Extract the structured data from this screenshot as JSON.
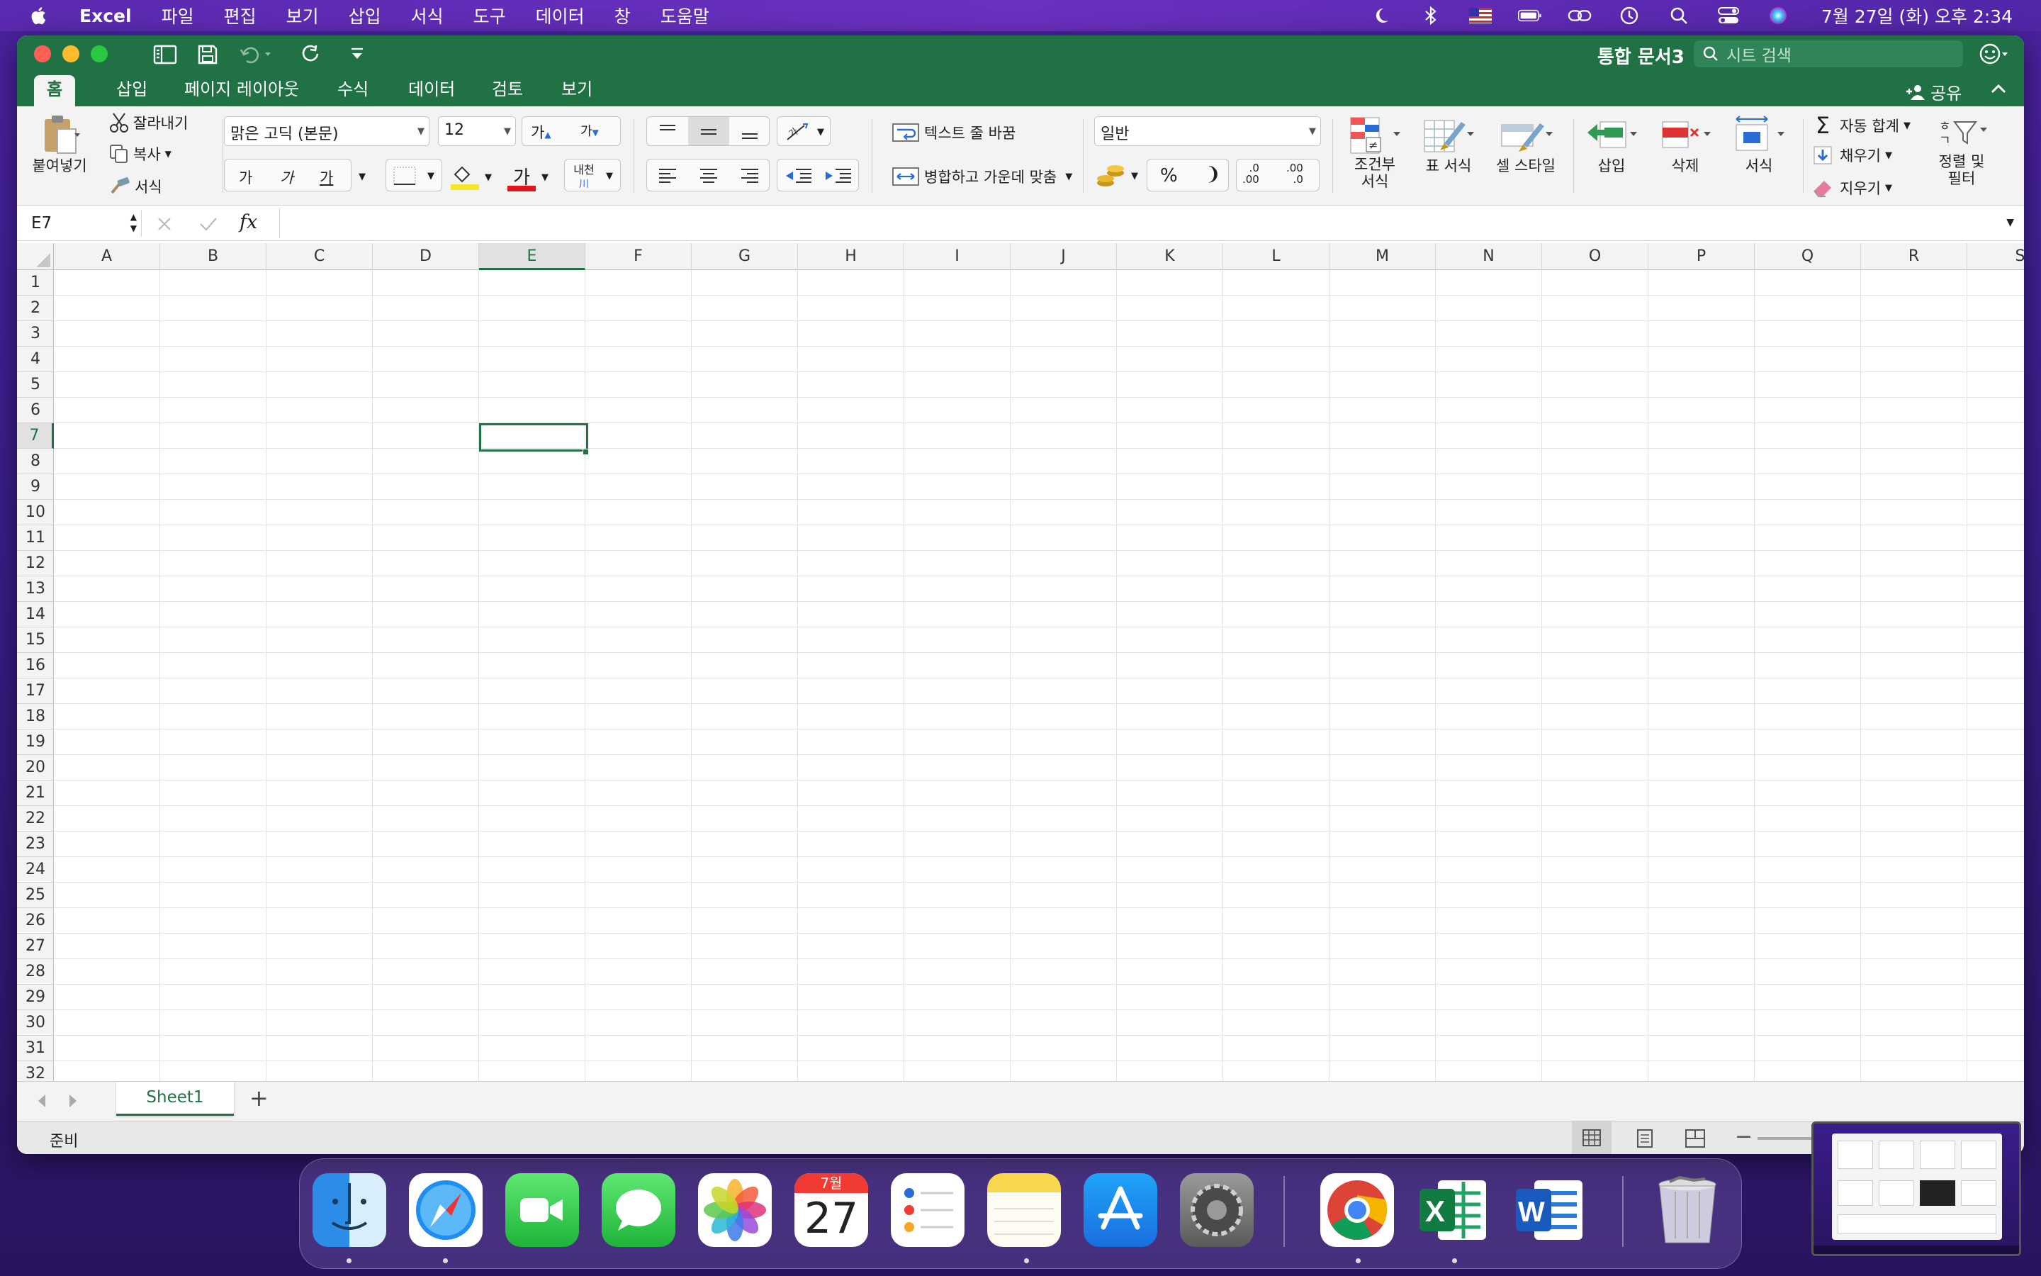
{
  "menubar": {
    "app": "Excel",
    "items": [
      "파일",
      "편집",
      "보기",
      "삽입",
      "서식",
      "도구",
      "데이터",
      "창",
      "도움말"
    ],
    "clock": "7월 27일 (화) 오후 2:34"
  },
  "window": {
    "title": "통합 문서3",
    "search_placeholder": "시트 검색"
  },
  "tabs": [
    "홈",
    "삽입",
    "페이지 레이아웃",
    "수식",
    "데이터",
    "검토",
    "보기"
  ],
  "share": "공유",
  "ribbon": {
    "paste": "붙여넣기",
    "cut": "잘라내기",
    "copy": "복사",
    "format_painter": "서식",
    "font": "맑은 고딕 (본문)",
    "font_size": "12",
    "grow": "가",
    "shrink": "가",
    "bold": "가",
    "italic": "가",
    "underline": "가",
    "font_color_glyph": "가",
    "phonetic": "내천",
    "wrap": "텍스트 줄 바꿈",
    "merge": "병합하고 가운데 맞춤",
    "number_format": "일반",
    "percent": "%",
    "comma": "❩",
    "inc_decimal": ".0\n.00",
    "dec_decimal": ".00\n.0",
    "cond_format": "조건부\n서식",
    "table_format": "표 서식",
    "cell_style": "셀 스타일",
    "insert": "삽입",
    "delete": "삭제",
    "format": "서식",
    "autosum": "자동 합계",
    "fill": "채우기",
    "clear": "지우기",
    "sort_filter": "정렬 및\n필터"
  },
  "formula": {
    "namebox": "E7",
    "fx": "fx",
    "value": ""
  },
  "columns": [
    "A",
    "B",
    "C",
    "D",
    "E",
    "F",
    "G",
    "H",
    "I",
    "J",
    "K",
    "L",
    "M",
    "N",
    "O",
    "P",
    "Q",
    "R",
    "S"
  ],
  "selected_col": "E",
  "rows": [
    "1",
    "2",
    "3",
    "4",
    "5",
    "6",
    "7",
    "8",
    "9",
    "10",
    "11",
    "12",
    "13",
    "14",
    "15",
    "16",
    "17",
    "18",
    "19",
    "20",
    "21",
    "22",
    "23",
    "24",
    "25",
    "26",
    "27",
    "28",
    "29",
    "30",
    "31",
    "32"
  ],
  "selected_row": "7",
  "sheet": {
    "tab": "Sheet1",
    "add": "+"
  },
  "status": "준비",
  "calendar": {
    "month": "7월",
    "day": "27"
  },
  "dock_apps": [
    "finder-icon",
    "safari-icon",
    "facetime-icon",
    "messages-icon",
    "photos-icon",
    "calendar-icon",
    "reminders-icon",
    "notes-icon",
    "app-store-icon",
    "system-preferences-icon",
    "chrome-icon",
    "excel-icon",
    "word-icon",
    "trash-icon"
  ]
}
